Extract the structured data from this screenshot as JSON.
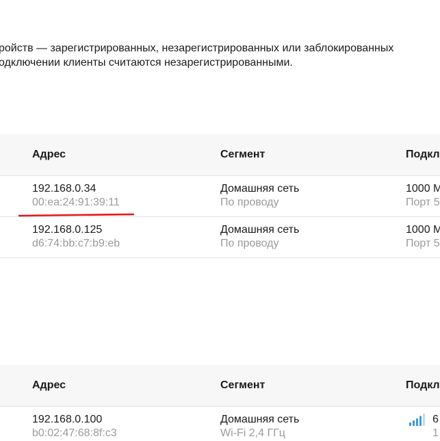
{
  "intro": {
    "line1": "ройств — зарегистрированных, незарегистрированных или заблокированных",
    "line2": "одключении клиенты считаются незарегистрированными."
  },
  "table_a": {
    "headers": {
      "address": "Адрес",
      "segment": "Сегмент",
      "connection": "Подкл"
    },
    "rows": [
      {
        "ip": "192.168.0.34",
        "mac": "00:ea:24:91:39:11",
        "segment": "Домашняя сеть",
        "medium": "По проводу",
        "speed": "1000 М",
        "port": "Порт 5"
      },
      {
        "ip": "192.168.0.125",
        "mac": "d6:74:bb:c7:b9:eb",
        "segment": "Домашняя сеть",
        "medium": "По проводу",
        "speed": "1000 М",
        "port": "Порт 5"
      }
    ]
  },
  "table_b": {
    "headers": {
      "address": "Адрес",
      "segment": "Сегмент",
      "connection": "Подкл"
    },
    "rows": [
      {
        "ip": "192.168.0.100",
        "mac": "b0:02:47:68:8f:c3",
        "segment": "Домашняя сеть",
        "medium": "Wi-Fi 2,4 ГГц",
        "signal_value": "6",
        "signal_sub": "1",
        "signal_icon": "wifi-signal-bars-icon"
      }
    ]
  },
  "colors": {
    "annotation": "#e8141c",
    "signal": "#3b9be0",
    "signal_inactive": "#c8d8e8"
  }
}
